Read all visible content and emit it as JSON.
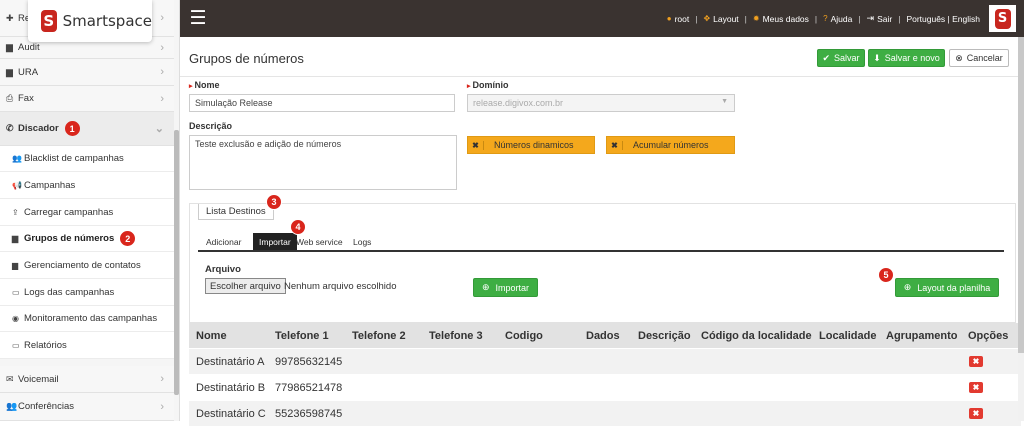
{
  "brand": {
    "name": "Smartspace",
    "logo_letter": "S",
    "color": "#c8261e"
  },
  "sidebar": {
    "items_top": [
      {
        "label": "Re",
        "icon": "plus-circle-icon"
      },
      {
        "label": "Audit",
        "icon": "book-icon"
      },
      {
        "label": "URA",
        "icon": "book-icon"
      },
      {
        "label": "Fax",
        "icon": "print-icon"
      }
    ],
    "discador": {
      "label": "Discador",
      "icon": "phone-icon",
      "badge": "1"
    },
    "sub_items": [
      {
        "label": "Blacklist de campanhas",
        "icon": "users-x-icon"
      },
      {
        "label": "Campanhas",
        "icon": "megaphone-icon"
      },
      {
        "label": "Carregar campanhas",
        "icon": "upload-icon"
      },
      {
        "label": "Grupos de números",
        "icon": "book-icon",
        "badge": "2"
      },
      {
        "label": "Gerenciamento de contatos",
        "icon": "book-icon"
      },
      {
        "label": "Logs das campanhas",
        "icon": "file-icon"
      },
      {
        "label": "Monitoramento das campanhas",
        "icon": "eye-icon"
      },
      {
        "label": "Relatórios",
        "icon": "file-icon"
      }
    ],
    "items_bottom": [
      {
        "label": "Voicemail",
        "icon": "mail-icon"
      },
      {
        "label": "Conferências",
        "icon": "users-icon"
      }
    ]
  },
  "topbar": {
    "user": "root",
    "layout": "Layout",
    "my_data": "Meus dados",
    "help": "Ajuda",
    "logout": "Sair",
    "languages": "Português | English",
    "separator": "|"
  },
  "page": {
    "title": "Grupos de números",
    "save_label": "Salvar",
    "save_new_label": "Salvar e novo",
    "cancel_label": "Cancelar",
    "name_label": "Nome",
    "name_value": "Simulação Release",
    "domain_label": "Domínio",
    "domain_value": "release.digivox.com.br",
    "description_label": "Descrição",
    "description_value": "Teste exclusão e adição de números",
    "dynamic_numbers_label": "Números dinamicos",
    "accumulate_numbers_label": "Acumular números"
  },
  "panel": {
    "tab_label": "Lista Destinos",
    "tab_badge": "3",
    "subtabs": [
      "Adicionar",
      "Importar",
      "Web service",
      "Logs"
    ],
    "subtab_badge": "4",
    "file_label": "Arquivo",
    "choose_file_label": "Escolher arquivo",
    "no_file_label": "Nenhum arquivo escolhido",
    "import_label": "Importar",
    "layout_label": "Layout da planilha",
    "layout_badge": "5"
  },
  "table": {
    "headers": [
      "Nome",
      "Telefone 1",
      "Telefone 2",
      "Telefone 3",
      "Codigo",
      "Dados",
      "Descrição",
      "Código da localidade",
      "Localidade",
      "Agrupamento",
      "Opções"
    ],
    "rows": [
      [
        "Destinatário A",
        "99785632145"
      ],
      [
        "Destinatário B",
        "77986521478"
      ],
      [
        "Destinatário C",
        "55236598745"
      ]
    ],
    "delete_glyph": "✖"
  }
}
